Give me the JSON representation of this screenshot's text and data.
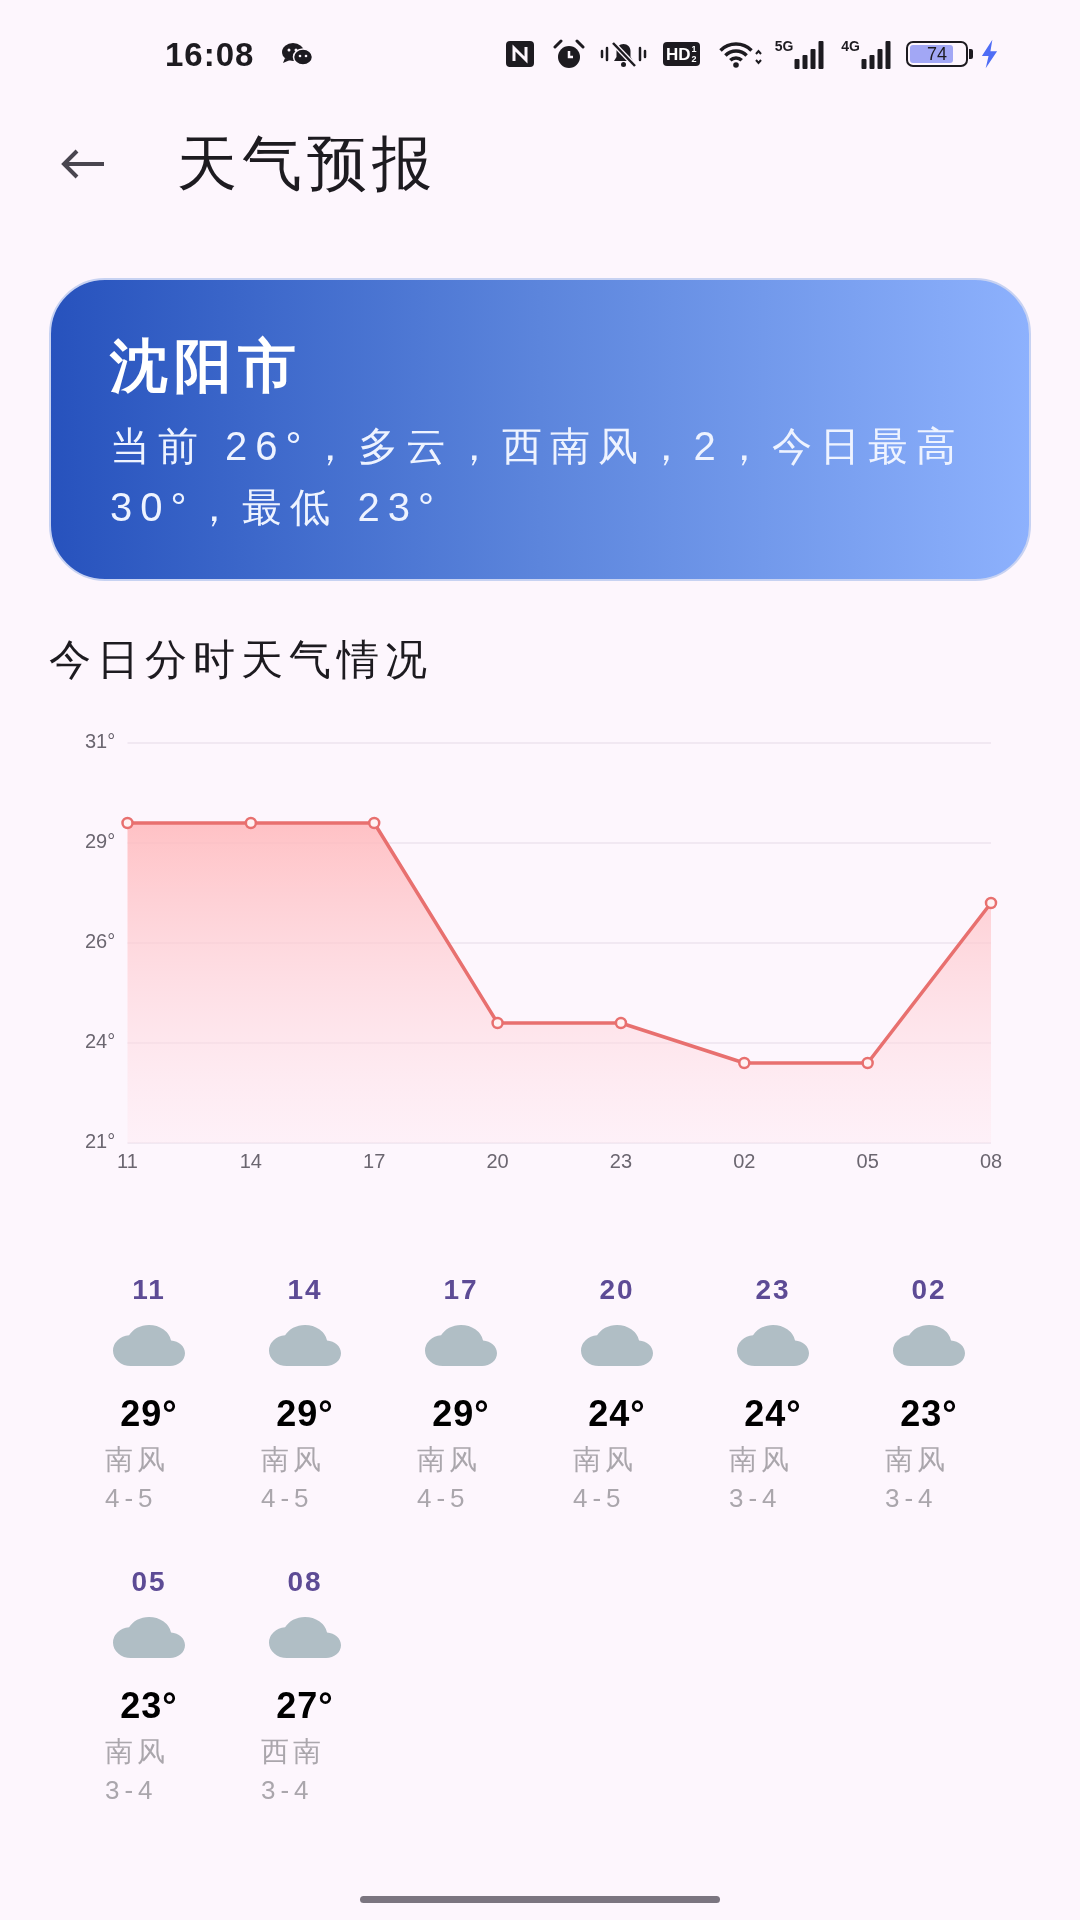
{
  "status_bar": {
    "time": "16:08",
    "hd_badge": {
      "label": "HD",
      "slots": [
        "1",
        "2"
      ]
    },
    "networks": [
      "5G",
      "4G"
    ],
    "battery": "74"
  },
  "header": {
    "title": "天气预报"
  },
  "city_card": {
    "city": "沈阳市",
    "summary": "当前 26°，多云，西南风，2，今日最高 30°，最低 23°"
  },
  "hourly_section": {
    "title": "今日分时天气情况",
    "chart_data": {
      "type": "area",
      "categories": [
        "11",
        "14",
        "17",
        "20",
        "23",
        "02",
        "05",
        "08"
      ],
      "values": [
        29,
        29,
        29,
        24,
        24,
        23,
        23,
        27
      ],
      "ylim": [
        21,
        31
      ],
      "yticks": [
        {
          "value": 21,
          "label": "21°"
        },
        {
          "value": 23.5,
          "label": "24°"
        },
        {
          "value": 26,
          "label": "26°"
        },
        {
          "value": 28.5,
          "label": "29°"
        },
        {
          "value": 31,
          "label": "31°"
        }
      ],
      "grid": true
    }
  },
  "hourly_forecast": [
    {
      "hour": "11",
      "temperature": "29°",
      "wind_direction": "南风",
      "wind_level": "4-5"
    },
    {
      "hour": "14",
      "temperature": "29°",
      "wind_direction": "南风",
      "wind_level": "4-5"
    },
    {
      "hour": "17",
      "temperature": "29°",
      "wind_direction": "南风",
      "wind_level": "4-5"
    },
    {
      "hour": "20",
      "temperature": "24°",
      "wind_direction": "南风",
      "wind_level": "4-5"
    },
    {
      "hour": "23",
      "temperature": "24°",
      "wind_direction": "南风",
      "wind_level": "3-4"
    },
    {
      "hour": "02",
      "temperature": "23°",
      "wind_direction": "南风",
      "wind_level": "3-4"
    },
    {
      "hour": "05",
      "temperature": "23°",
      "wind_direction": "南风",
      "wind_level": "3-4"
    },
    {
      "hour": "08",
      "temperature": "27°",
      "wind_direction": "西南",
      "wind_level": "3-4"
    }
  ]
}
